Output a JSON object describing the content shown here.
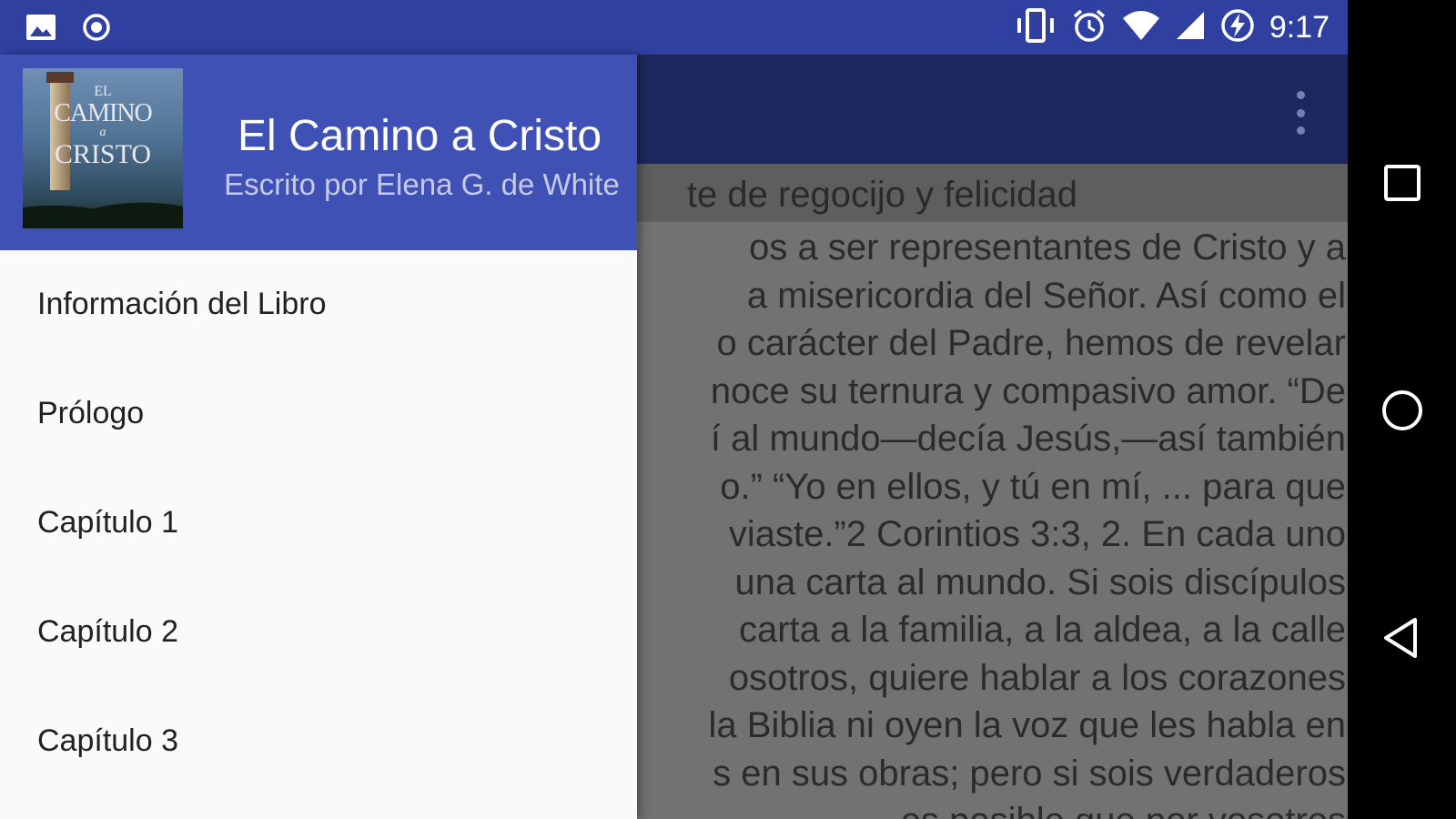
{
  "status_bar": {
    "time": "9:17",
    "left_icons": [
      "image-icon",
      "record-icon"
    ],
    "right_icons": [
      "vibrate-icon",
      "alarm-icon",
      "wifi-icon",
      "cell-signal-icon",
      "battery-charging-icon"
    ]
  },
  "app_bar": {
    "overflow_icon": "more-vert-icon"
  },
  "drawer": {
    "cover": {
      "line1": "EL",
      "line2": "CAMINO",
      "line3": "a",
      "line4": "CRISTO"
    },
    "title": "El Camino a Cristo",
    "subtitle": "Escrito por Elena G. de White",
    "colors": {
      "header": "#3F51B5",
      "status_bar": "#3040A0"
    },
    "menu_items": [
      {
        "label": "Información del Libro"
      },
      {
        "label": "Prólogo"
      },
      {
        "label": "Capítulo 1"
      },
      {
        "label": "Capítulo 2"
      },
      {
        "label": "Capítulo 3"
      }
    ]
  },
  "content": {
    "chapter_heading": "te de regocijo y felicidad",
    "lines": [
      "os a ser representantes de Cristo y a",
      "a misericordia del Señor. Así como el",
      "o carácter del Padre, hemos de revelar",
      "noce su ternura y compasivo amor. “De",
      "í al mundo—decía Jesús,—así también",
      "o.” “Yo en ellos, y tú en mí, ... para que",
      "viaste.”2 Corintios 3:3, 2. En cada uno",
      "una carta al mundo. Si sois discípulos",
      "carta a la familia, a la aldea, a la calle",
      "osotros, quiere hablar a los corazones",
      "la Biblia ni oyen la voz que les habla en",
      "s en sus obras; pero si sois verdaderos",
      "es posible que por vosotros"
    ]
  },
  "nav_bar": {
    "icons": [
      "recents-icon",
      "home-icon",
      "back-icon"
    ]
  }
}
